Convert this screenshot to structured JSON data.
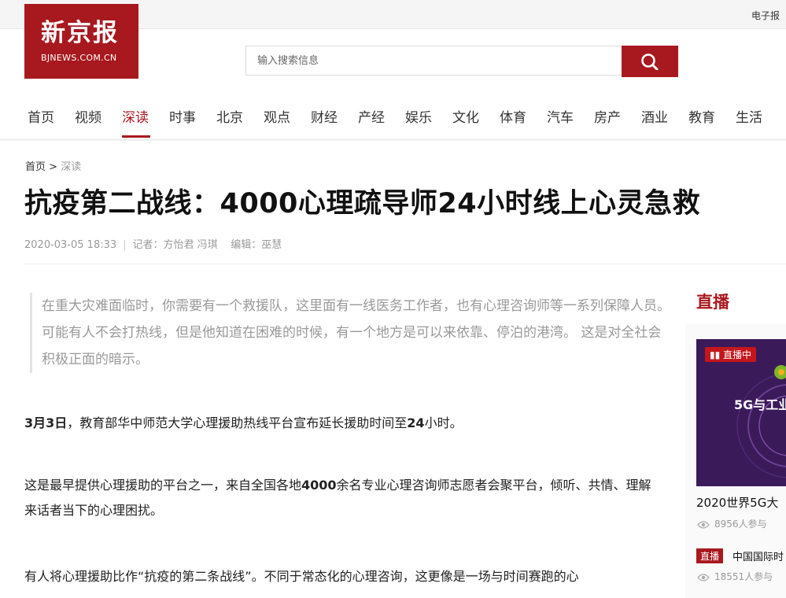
{
  "topbar": {
    "epaper_label": "电子报"
  },
  "logo": {
    "main": "新京报",
    "sub": "BJNEWS.COM.CN"
  },
  "search": {
    "placeholder": "输入搜索信息"
  },
  "nav": {
    "items": [
      "首页",
      "视频",
      "深读",
      "时事",
      "北京",
      "观点",
      "财经",
      "产经",
      "娱乐",
      "文化",
      "体育",
      "汽车",
      "房产",
      "酒业",
      "教育",
      "生活"
    ],
    "active": "深读"
  },
  "breadcrumb": {
    "home": "首页",
    "separator": ">",
    "current": "深读"
  },
  "article": {
    "title": "抗疫第二战线：4000心理疏导师24小时线上心灵急救",
    "date": "2020-03-05 18:33",
    "reporter": "记者：方怡君 冯琪",
    "editor": "编辑：巫慧",
    "quote": "在重大灾难面临时，你需要有一个救援队，这里面有一线医务工作者，也有心理咨询师等一系列保障人员。可能有人不会打热线，但是他知道在困难的时候，有一个地方是可以来依靠、停泊的港湾。 这是对全社会积极正面的暗示。",
    "p1": {
      "bold1": "3月3日",
      "t1": "，教育部华中师范大学心理援助热线平台宣布延长援助时间至",
      "bold2": "24",
      "t2": "小时。"
    },
    "p2": {
      "t1": "这是最早提供心理援助的平台之一，来自全国各地",
      "bold1": "4000",
      "t2": "余名专业心理咨询师志愿者会聚平台，倾听、共情、理解来话者当下的心理困扰。"
    },
    "p3": "有人将心理援助比作“抗疫的第二条战线”。不同于常态化的心理咨询，这更像是一场与时间赛跑的心"
  },
  "sidebar": {
    "title": "直播",
    "item1": {
      "badge": "直播中",
      "image_text": "5G与工业",
      "title": "2020世界5G大",
      "count": "8956人参与"
    },
    "item2": {
      "badge": "直播",
      "title": "中国国际时",
      "count": "18551人参与"
    }
  },
  "colors": {
    "brand": "#a8191f"
  }
}
